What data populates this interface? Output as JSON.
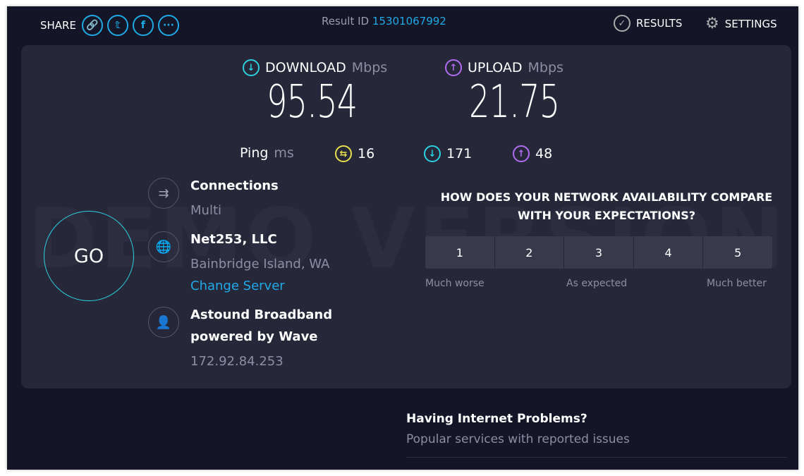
{
  "header": {
    "share_label": "SHARE",
    "share_icons": [
      "link-icon",
      "twitter-icon",
      "facebook-icon",
      "more-icon"
    ],
    "result_id_label": "Result ID",
    "result_id": "15301067992",
    "results_label": "RESULTS",
    "settings_label": "SETTINGS"
  },
  "speeds": {
    "download_label": "DOWNLOAD",
    "upload_label": "UPLOAD",
    "unit": "Mbps",
    "download": "95.54",
    "upload": "21.75"
  },
  "ping": {
    "label": "Ping",
    "unit": "ms",
    "idle": "16",
    "download": "171",
    "upload": "48"
  },
  "watermark": "DEMO VERSION",
  "go_label": "GO",
  "connections": {
    "title": "Connections",
    "value": "Multi"
  },
  "server": {
    "name": "Net253, LLC",
    "location": "Bainbridge Island, WA",
    "change_label": "Change Server"
  },
  "isp": {
    "name_line1": "Astound Broadband",
    "name_line2": "powered by Wave",
    "ip": "172.92.84.253"
  },
  "survey": {
    "question_line1": "HOW DOES YOUR NETWORK AVAILABILITY COMPARE",
    "question_line2": "WITH YOUR EXPECTATIONS?",
    "options": [
      "1",
      "2",
      "3",
      "4",
      "5"
    ],
    "low": "Much worse",
    "mid": "As expected",
    "high": "Much better"
  },
  "problems": {
    "title": "Having Internet Problems?",
    "subtitle": "Popular services with reported issues"
  },
  "colors": {
    "accent": "#1fa9e6",
    "download": "#2bd1e0",
    "upload": "#b26cf2",
    "ping": "#e8df4a",
    "background": "#141526",
    "card": "#262839"
  }
}
